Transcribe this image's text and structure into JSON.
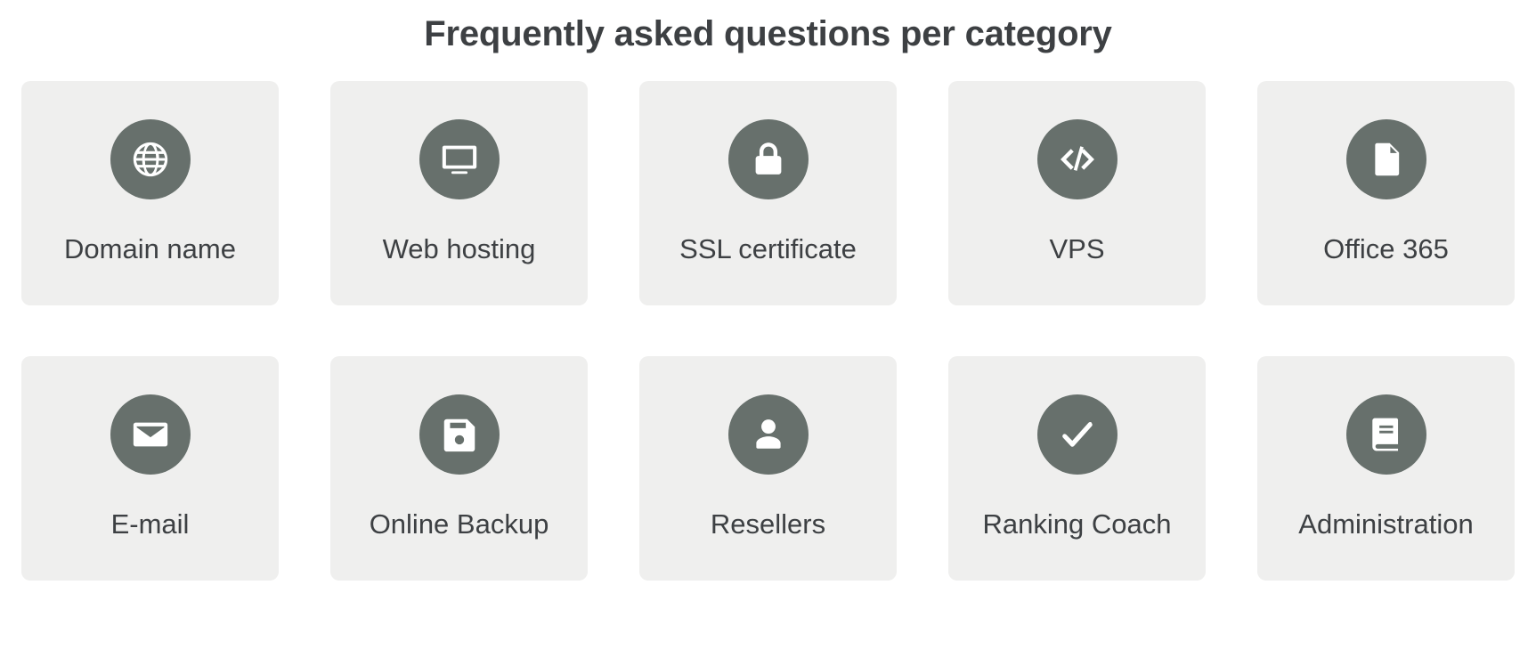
{
  "header": {
    "title": "Frequently asked questions per category"
  },
  "colors": {
    "card_background": "#efefee",
    "icon_circle": "#67706c",
    "icon_glyph": "#ffffff",
    "text": "#3d4043",
    "page_background": "#ffffff"
  },
  "categories": [
    {
      "label": "Domain name",
      "icon": "globe-icon"
    },
    {
      "label": "Web hosting",
      "icon": "monitor-icon"
    },
    {
      "label": "SSL certificate",
      "icon": "lock-icon"
    },
    {
      "label": "VPS",
      "icon": "code-icon"
    },
    {
      "label": "Office 365",
      "icon": "document-icon"
    },
    {
      "label": "E-mail",
      "icon": "envelope-icon"
    },
    {
      "label": "Online Backup",
      "icon": "floppy-disk-icon"
    },
    {
      "label": "Resellers",
      "icon": "user-icon"
    },
    {
      "label": "Ranking Coach",
      "icon": "check-icon"
    },
    {
      "label": "Administration",
      "icon": "book-icon"
    }
  ]
}
